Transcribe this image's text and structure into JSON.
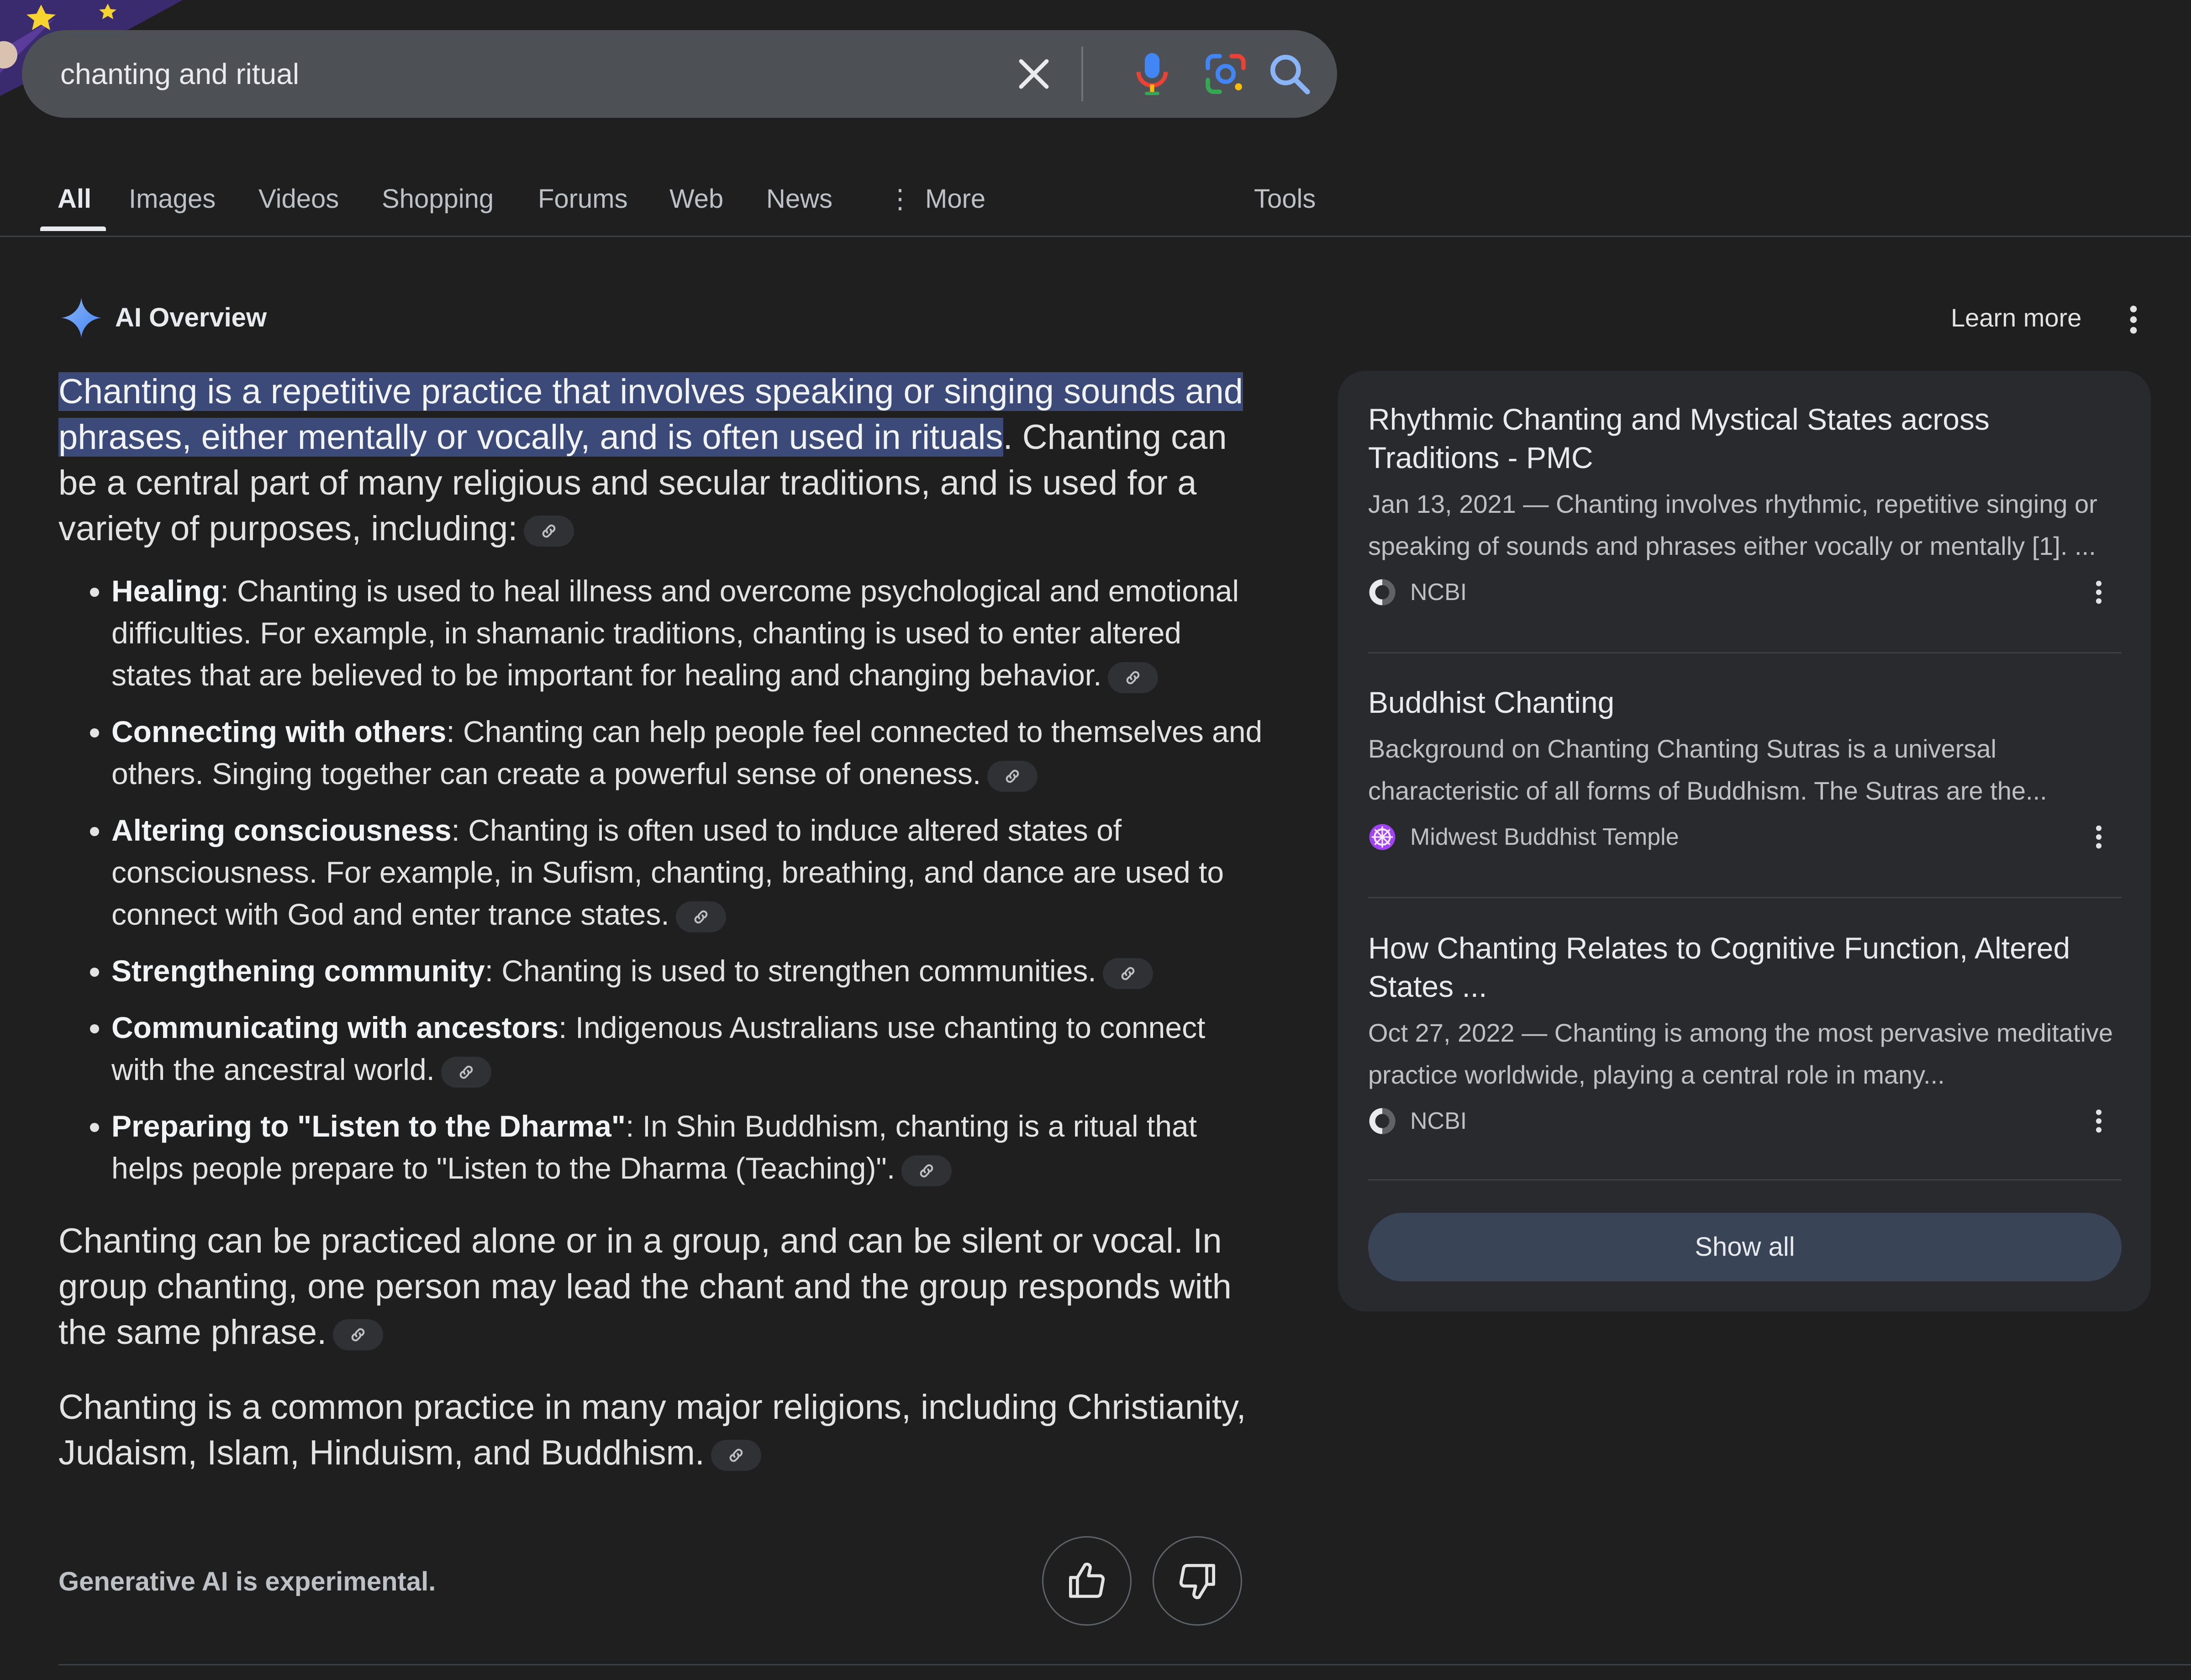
{
  "search": {
    "query": "chanting and ritual"
  },
  "tabs": [
    {
      "label": "All",
      "active": true
    },
    {
      "label": "Images"
    },
    {
      "label": "Videos"
    },
    {
      "label": "Shopping"
    },
    {
      "label": "Forums"
    },
    {
      "label": "Web"
    },
    {
      "label": "News"
    },
    {
      "label": "More"
    },
    {
      "label": "Tools"
    }
  ],
  "overview": {
    "title": "AI Overview",
    "learn_more": "Learn more",
    "lead_highlight": "Chanting is a repetitive practice that involves speaking or singing sounds and phrases, either mentally or vocally, and is often used in rituals",
    "lead_rest": ". Chanting can be a central part of many religious and secular traditions, and is used for a variety of purposes, including:",
    "bullets": [
      {
        "term": "Healing",
        "text": ": Chanting is used to heal illness and overcome psychological and emotional difficulties. For example, in shamanic traditions, chanting is used to enter altered states that are believed to be important for healing and changing behavior."
      },
      {
        "term": "Connecting with others",
        "text": ": Chanting can help people feel connected to themselves and others. Singing together can create a powerful sense of oneness."
      },
      {
        "term": "Altering consciousness",
        "text": ": Chanting is often used to induce altered states of consciousness. For example, in Sufism, chanting, breathing, and dance are used to connect with God and enter trance states."
      },
      {
        "term": "Strengthening community",
        "text": ": Chanting is used to strengthen communities."
      },
      {
        "term": "Communicating with ancestors",
        "text": ": Indigenous Australians use chanting to connect with the ancestral world."
      },
      {
        "term": "Preparing to \"Listen to the Dharma\"",
        "text": ": In Shin Buddhism, chanting is a ritual that helps people prepare to \"Listen to the Dharma (Teaching)\"."
      }
    ],
    "para2": "Chanting can be practiced alone or in a group, and can be silent or vocal. In group chanting, one person may lead the chant and the group responds with the same phrase.",
    "para3": "Chanting is a common practice in many major religions, including Christianity, Judaism, Islam, Hinduism, and Buddhism.",
    "footnote": "Generative AI is experimental."
  },
  "sources": [
    {
      "title": "Rhythmic Chanting and Mystical States across Traditions - PMC",
      "snippet": "Jan 13, 2021 — Chanting involves rhythmic, repetitive singing or speaking of sounds and phrases either vocally or mentally [1]. ...",
      "site": "NCBI"
    },
    {
      "title": "Buddhist Chanting",
      "snippet": "Background on Chanting Chanting Sutras is a universal characteristic of all forms of Buddhism. The Sutras are the...",
      "site": "Midwest Buddhist Temple"
    },
    {
      "title": "How Chanting Relates to Cognitive Function, Altered States ...",
      "snippet": "Oct 27, 2022 — Chanting is among the most pervasive meditative practice worldwide, playing a central role in many...",
      "site": "NCBI"
    }
  ],
  "show_all": "Show all",
  "colors": {
    "background": "#1f1f1f",
    "highlight": "#3c4a7a",
    "panel": "#282a2d",
    "show_all_button": "#394457"
  }
}
